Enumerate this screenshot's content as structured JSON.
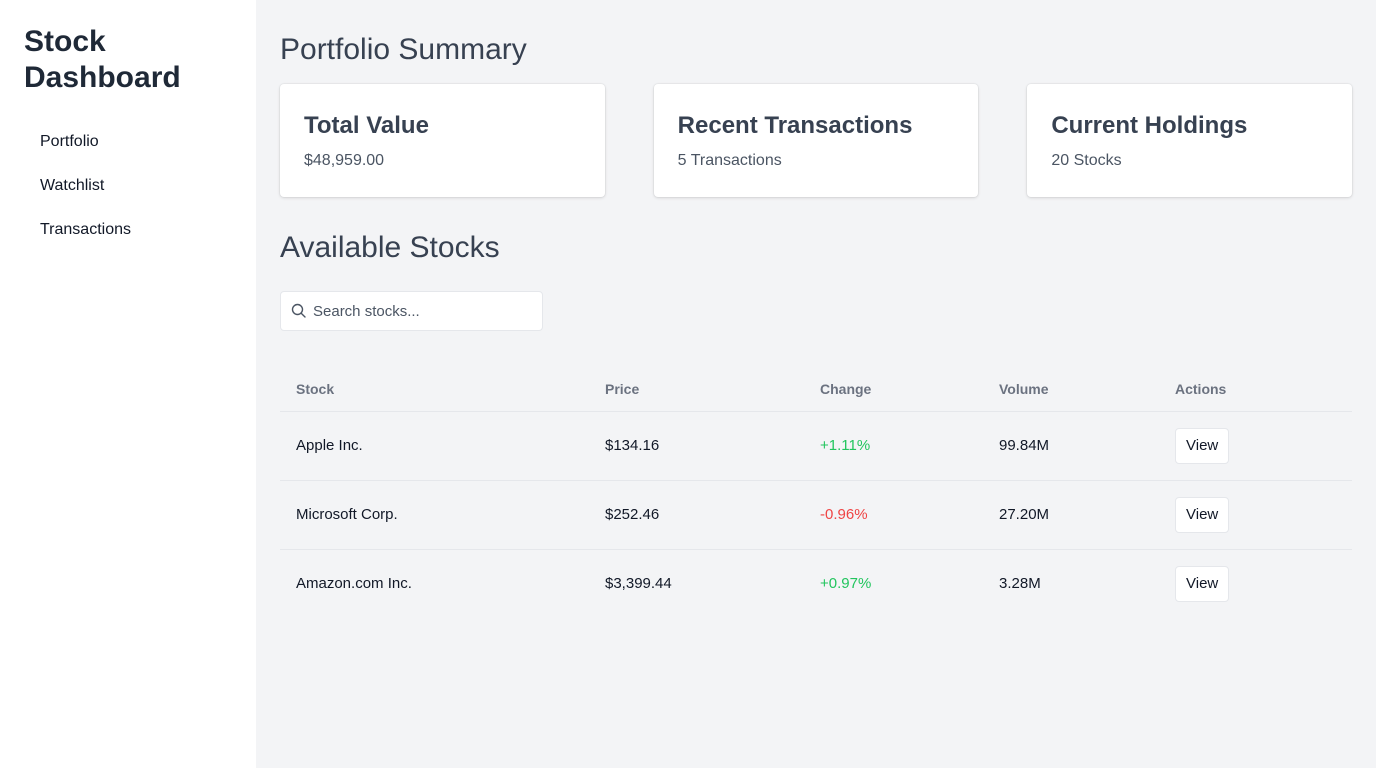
{
  "sidebar": {
    "brand": "Stock Dashboard",
    "items": [
      {
        "label": "Portfolio"
      },
      {
        "label": "Watchlist"
      },
      {
        "label": "Transactions"
      }
    ]
  },
  "summary": {
    "title": "Portfolio Summary",
    "cards": [
      {
        "title": "Total Value",
        "value": "$48,959.00"
      },
      {
        "title": "Recent Transactions",
        "value": "5 Transactions"
      },
      {
        "title": "Current Holdings",
        "value": "20 Stocks"
      }
    ]
  },
  "stocks": {
    "title": "Available Stocks",
    "search_placeholder": "Search stocks...",
    "search_icon": "search-icon",
    "headers": [
      "Stock",
      "Price",
      "Change",
      "Volume",
      "Actions"
    ],
    "rows": [
      {
        "stock": "Apple Inc.",
        "price": "$134.16",
        "change": "+1.11%",
        "direction": "up",
        "volume": "99.84M",
        "action": "View"
      },
      {
        "stock": "Microsoft Corp.",
        "price": "$252.46",
        "change": "-0.96%",
        "direction": "down",
        "volume": "27.20M",
        "action": "View"
      },
      {
        "stock": "Amazon.com Inc.",
        "price": "$3,399.44",
        "change": "+0.97%",
        "direction": "up",
        "volume": "3.28M",
        "action": "View"
      }
    ]
  },
  "colors": {
    "positive": "#22c55e",
    "negative": "#ef4444",
    "background": "#f3f4f6",
    "sidebar": "#ffffff"
  }
}
